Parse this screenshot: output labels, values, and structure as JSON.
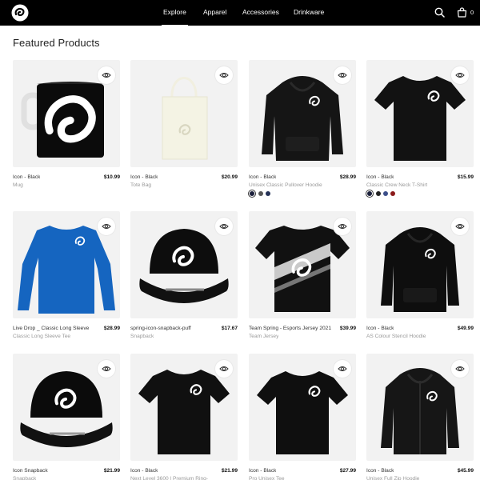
{
  "header": {
    "nav": [
      "Explore",
      "Apparel",
      "Accessories",
      "Drinkware"
    ],
    "cart_count": "0"
  },
  "section_title": "Featured Products",
  "products": [
    {
      "name": "Icon - Black",
      "price": "$10.99",
      "subtitle": "Mug",
      "art": "mug",
      "swatches": []
    },
    {
      "name": "Icon - Black",
      "price": "$20.99",
      "subtitle": "Tote Bag",
      "art": "tote",
      "swatches": []
    },
    {
      "name": "Icon - Black",
      "price": "$28.99",
      "subtitle": "Unisex Classic Pullover Hoodie",
      "art": "hoodie",
      "swatches": [
        "#1a1f3a",
        "#555555",
        "#243156"
      ]
    },
    {
      "name": "Icon - Black",
      "price": "$15.99",
      "subtitle": "Classic Crew Neck T-Shirt",
      "art": "tshirt",
      "swatches": [
        "#1a1f3a",
        "#222222",
        "#3c4f8a",
        "#8b1a1a"
      ]
    },
    {
      "name": "Live Drop _ Classic Long Sleeve",
      "price": "$28.99",
      "subtitle": "Classic Long Sleeve Tee",
      "art": "longsleeve",
      "swatches": []
    },
    {
      "name": "spring-icon-snapback-puff",
      "price": "$17.67",
      "subtitle": "Snapback",
      "art": "snapback",
      "swatches": []
    },
    {
      "name": "Team Spring - Esports Jersey 2021",
      "price": "$39.99",
      "subtitle": "Team Jersey",
      "art": "jersey",
      "swatches": []
    },
    {
      "name": "Icon - Black",
      "price": "$49.99",
      "subtitle": "AS Colour Stencil Hoodie",
      "art": "hoodie2",
      "swatches": []
    },
    {
      "name": "Icon Snapback",
      "price": "$21.99",
      "subtitle": "Snapback",
      "art": "snapback2",
      "swatches": []
    },
    {
      "name": "Icon - Black",
      "price": "$21.99",
      "subtitle": "Next Level 3600 | Premium Ring-",
      "art": "tshirt2",
      "swatches": []
    },
    {
      "name": "Icon - Black",
      "price": "$27.99",
      "subtitle": "Pro Unisex Tee",
      "art": "tshirt3",
      "swatches": []
    },
    {
      "name": "Icon - Black",
      "price": "$45.99",
      "subtitle": "Unisex Full Zip Hoodie",
      "art": "ziphoodie",
      "swatches": []
    }
  ]
}
